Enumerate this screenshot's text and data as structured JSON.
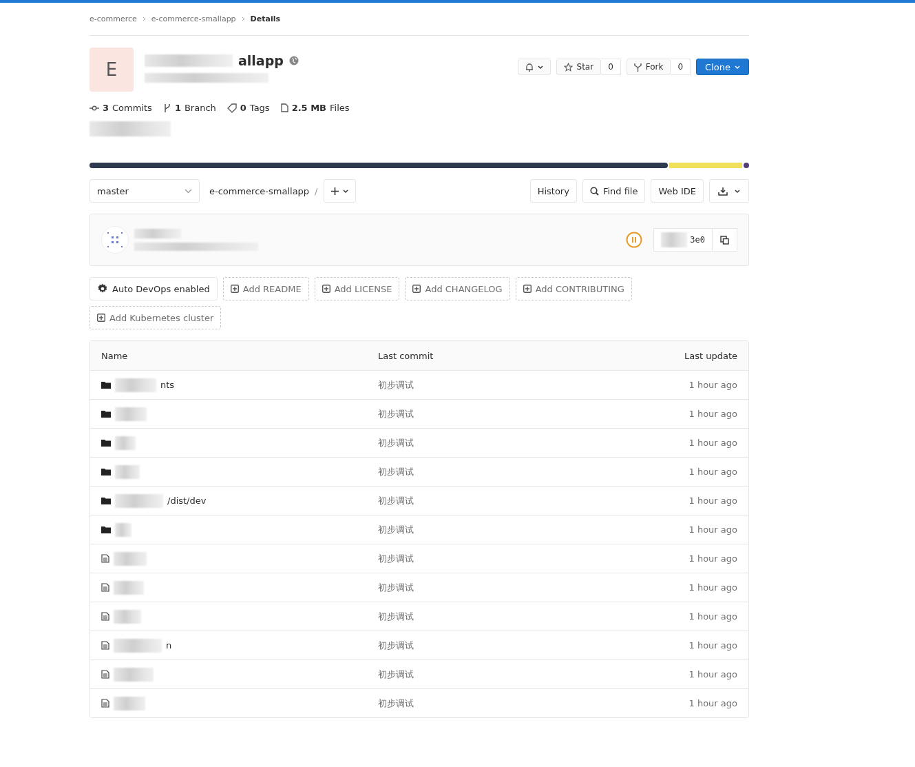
{
  "breadcrumbs": [
    {
      "label": "e-commerce",
      "current": false
    },
    {
      "label": "e-commerce-smallapp",
      "current": false
    },
    {
      "label": "Details",
      "current": true
    }
  ],
  "project": {
    "avatar_letter": "E",
    "name_visible": "allapp"
  },
  "header_buttons": {
    "star_label": "Star",
    "star_count": "0",
    "fork_label": "Fork",
    "fork_count": "0",
    "clone_label": "Clone"
  },
  "stats": [
    {
      "kind": "commits",
      "value": "3",
      "label": "Commits"
    },
    {
      "kind": "branch",
      "value": "1",
      "label": "Branch"
    },
    {
      "kind": "tags",
      "value": "0",
      "label": "Tags"
    },
    {
      "kind": "files",
      "value": "2.5 MB",
      "label": "Files"
    }
  ],
  "toolbar": {
    "branch": "master",
    "path": "e-commerce-smallapp",
    "separator": "/",
    "history": "History",
    "find_file": "Find file",
    "web_ide": "Web IDE"
  },
  "last_commit": {
    "sha_visible": "3e0"
  },
  "actions": [
    {
      "kind": "settings",
      "label": "Auto DevOps enabled"
    },
    {
      "kind": "add",
      "label": "Add README"
    },
    {
      "kind": "add",
      "label": "Add LICENSE"
    },
    {
      "kind": "add",
      "label": "Add CHANGELOG"
    },
    {
      "kind": "add",
      "label": "Add CONTRIBUTING"
    },
    {
      "kind": "add",
      "label": "Add Kubernetes cluster"
    }
  ],
  "table": {
    "columns": [
      "Name",
      "Last commit",
      "Last update"
    ],
    "rows": [
      {
        "kind": "folder",
        "name_visible": "nts",
        "commit": "初步调试",
        "updated": "1 hour ago"
      },
      {
        "kind": "folder",
        "commit": "初步调试",
        "updated": "1 hour ago"
      },
      {
        "kind": "folder",
        "commit": "初步调试",
        "updated": "1 hour ago"
      },
      {
        "kind": "folder",
        "commit": "初步调试",
        "updated": "1 hour ago"
      },
      {
        "kind": "folder",
        "name_visible": "/dist/dev",
        "commit": "初步调试",
        "updated": "1 hour ago"
      },
      {
        "kind": "folder",
        "commit": "初步调试",
        "updated": "1 hour ago"
      },
      {
        "kind": "file",
        "commit": "初步调试",
        "updated": "1 hour ago"
      },
      {
        "kind": "file",
        "commit": "初步调试",
        "updated": "1 hour ago"
      },
      {
        "kind": "file",
        "commit": "初步调试",
        "updated": "1 hour ago"
      },
      {
        "kind": "file",
        "name_visible": "n",
        "commit": "初步调试",
        "updated": "1 hour ago"
      },
      {
        "kind": "file",
        "commit": "初步调试",
        "updated": "1 hour ago"
      },
      {
        "kind": "file",
        "commit": "初步调试",
        "updated": "1 hour ago"
      }
    ]
  }
}
